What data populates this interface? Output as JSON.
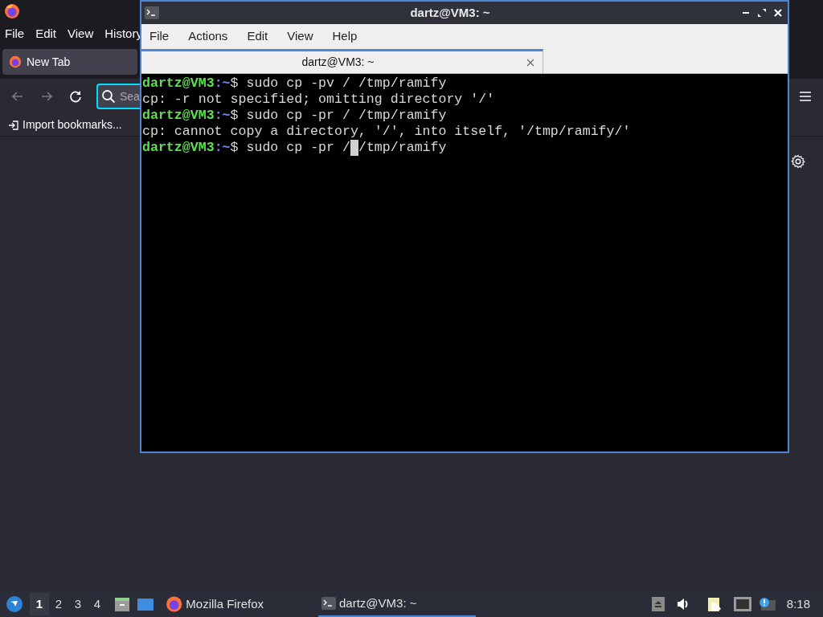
{
  "browser": {
    "menu": [
      "File",
      "Edit",
      "View",
      "History"
    ],
    "tab": {
      "title": "New Tab",
      "selected": true
    },
    "search": {
      "placeholder": "Sea"
    },
    "bookmarks": [
      "Import bookmarks..."
    ]
  },
  "terminal": {
    "window_title": "dartz@VM3: ~",
    "menu": [
      "File",
      "Actions",
      "Edit",
      "View",
      "Help"
    ],
    "tab": {
      "title": "dartz@VM3: ~",
      "selected": true
    },
    "lines": [
      {
        "kind": "prompt",
        "prompt": "dartz@VM3",
        "path": ":~",
        "sign": "$ ",
        "command": "sudo cp -pv / /tmp/ramify"
      },
      {
        "kind": "output",
        "text": "cp: -r not specified; omitting directory '/'"
      },
      {
        "kind": "prompt",
        "prompt": "dartz@VM3",
        "path": ":~",
        "sign": "$ ",
        "command": "sudo cp -pr / /tmp/ramify"
      },
      {
        "kind": "output",
        "text": "cp: cannot copy a directory, '/', into itself, '/tmp/ramify/'"
      },
      {
        "kind": "prompt",
        "prompt": "dartz@VM3",
        "path": ":~",
        "sign": "$ ",
        "command": "sudo cp -pr /",
        "cursor": true,
        "command_after_cursor": "/tmp/ramify"
      }
    ]
  },
  "taskbar": {
    "workspaces": [
      {
        "label": "1",
        "selected": true
      },
      {
        "label": "2",
        "selected": false
      },
      {
        "label": "3",
        "selected": false
      },
      {
        "label": "4",
        "selected": false
      }
    ],
    "tasks": [
      {
        "title": "Mozilla Firefox",
        "kind": "firefox",
        "selected": false
      },
      {
        "title": "dartz@VM3: ~",
        "kind": "terminal",
        "selected": true
      }
    ],
    "clock": "8:18"
  }
}
